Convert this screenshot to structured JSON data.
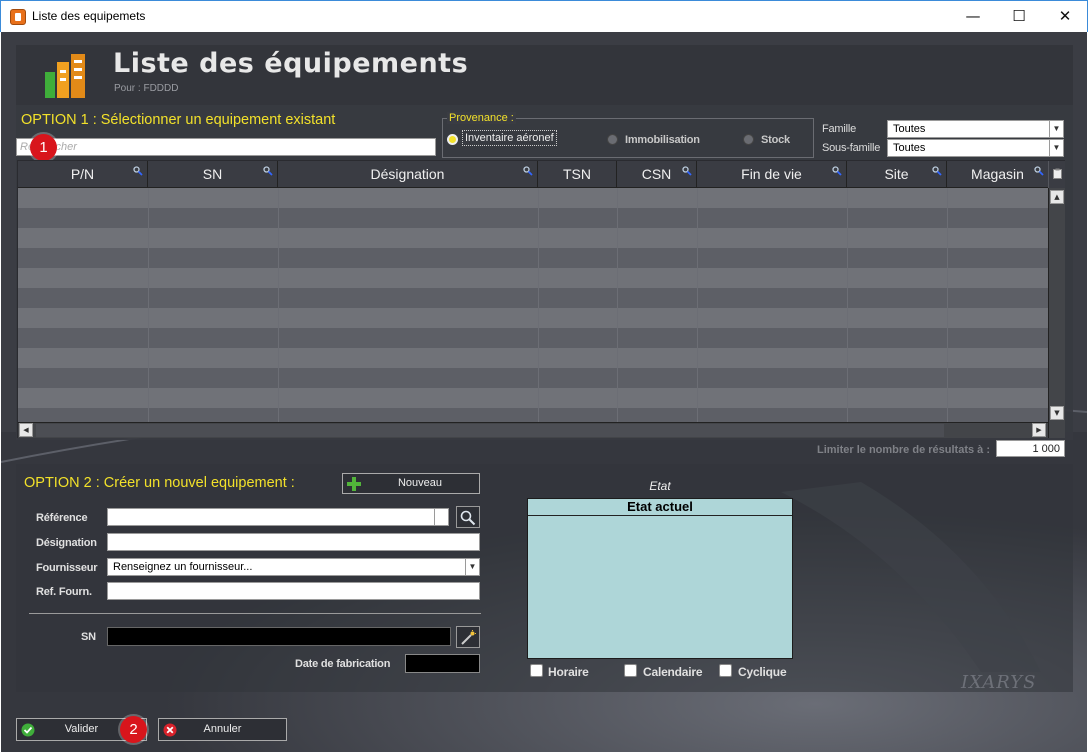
{
  "window": {
    "title": "Liste des equipemets"
  },
  "header": {
    "title": "Liste des équipements",
    "subtitle": "Pour : FDDDD"
  },
  "option1": {
    "title": "OPTION 1 : Sélectionner un equipement existant",
    "search_placeholder": "Rechercher",
    "provenance_label": "Provenance :",
    "provenance_options": [
      "Inventaire aéronef",
      "Immobilisation",
      "Stock"
    ],
    "provenance_selected": "Inventaire aéronef",
    "famille_label": "Famille",
    "famille_value": "Toutes",
    "sous_famille_label": "Sous-famille",
    "sous_famille_value": "Toutes"
  },
  "table": {
    "columns": [
      "P/N",
      "SN",
      "Désignation",
      "TSN",
      "CSN",
      "Fin de vie",
      "Site",
      "Magasin"
    ],
    "rows": []
  },
  "limit": {
    "label": "Limiter le nombre de résultats à :",
    "value": "1 000"
  },
  "option2": {
    "title": "OPTION 2 : Créer un nouvel equipement :",
    "nouveau_label": "Nouveau",
    "reference_label": "Référence",
    "reference_value": "",
    "designation_label": "Désignation",
    "designation_value": "",
    "fournisseur_label": "Fournisseur",
    "fournisseur_placeholder": "Renseignez un fournisseur...",
    "ref_fourn_label": "Ref. Fourn.",
    "ref_fourn_value": "",
    "sn_label": "SN",
    "sn_value": "",
    "date_fab_label": "Date de fabrication",
    "date_fab_value": ""
  },
  "etat": {
    "label": "Etat",
    "header": "Etat actuel",
    "checkboxes": [
      "Horaire",
      "Calendaire",
      "Cyclique"
    ]
  },
  "footer": {
    "valider": "Valider",
    "annuler": "Annuler"
  },
  "badges": {
    "b1": "1",
    "b2": "2"
  },
  "brand": {
    "logo_text": "IXARYS"
  },
  "colors": {
    "accent_yellow": "#f2e12a",
    "badge_red": "#d8151c",
    "etat_bg": "#aed6d8"
  },
  "icons": [
    "app-icon",
    "minimize-icon",
    "maximize-icon",
    "close-icon",
    "equipment-logo-icon",
    "search-icon",
    "magic-wand-icon",
    "plus-icon",
    "check-icon",
    "cancel-icon"
  ]
}
